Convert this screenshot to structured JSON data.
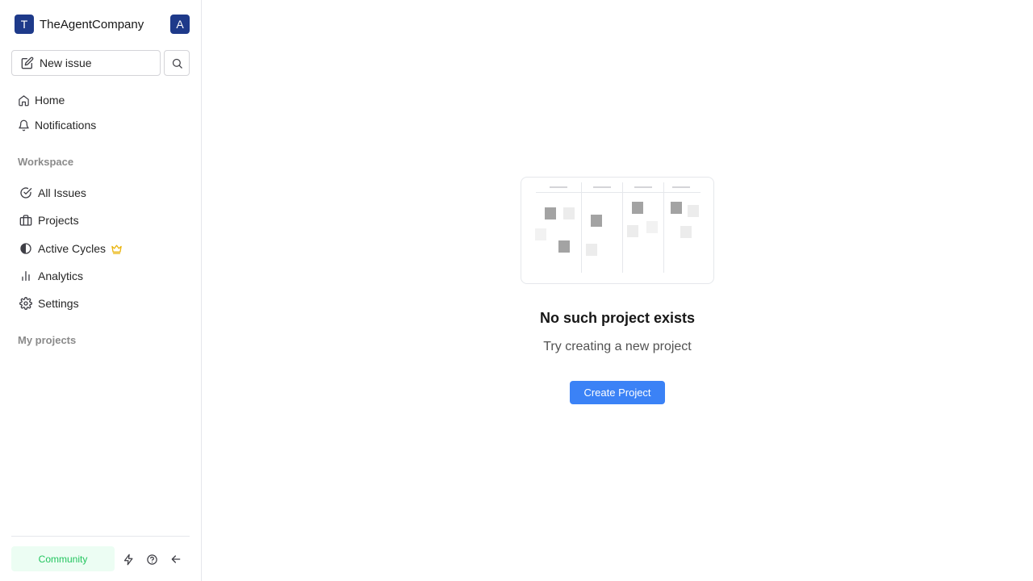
{
  "workspace": {
    "logo_letter": "T",
    "name": "TheAgentCompany",
    "avatar_letter": "A"
  },
  "sidebar": {
    "new_issue_label": "New issue",
    "top_items": [
      {
        "label": "Home",
        "icon": "home-icon"
      },
      {
        "label": "Notifications",
        "icon": "bell-icon"
      }
    ],
    "workspace_label": "Workspace",
    "workspace_items": [
      {
        "label": "All Issues",
        "icon": "check-circle-icon"
      },
      {
        "label": "Projects",
        "icon": "briefcase-icon"
      },
      {
        "label": "Active Cycles",
        "icon": "contrast-circle-icon",
        "badge_icon": "crown-icon"
      },
      {
        "label": "Analytics",
        "icon": "bar-chart-icon"
      },
      {
        "label": "Settings",
        "icon": "gear-icon"
      }
    ],
    "my_projects_label": "My projects",
    "footer": {
      "community_label": "Community",
      "icons": [
        "lightning-icon",
        "help-circle-icon",
        "arrow-left-icon"
      ]
    }
  },
  "main": {
    "empty_state": {
      "title": "No such project exists",
      "subtitle": "Try creating a new project",
      "button_label": "Create Project"
    }
  },
  "colors": {
    "brand_dark": "#1e3a8a",
    "primary_button": "#3b82f6",
    "community_bg": "#ecfdf3",
    "community_text": "#22c55e",
    "crown": "#eab308"
  }
}
